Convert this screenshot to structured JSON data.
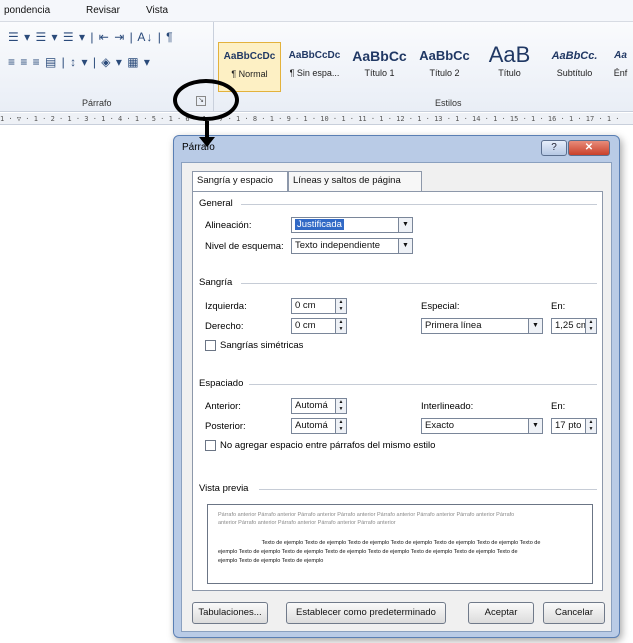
{
  "ribbon": {
    "menu": [
      "pondencia",
      "Revisar",
      "Vista"
    ],
    "paragraph_row1": "☰ ▾ ☰ ▾ ☰ ▾ | ⇤ ⇥ | A↓ | ¶",
    "paragraph_row2": "≡ ≡ ≡ ▤ | ↕ ▾ | ◈ ▾ ▦ ▾",
    "paragraph_group_label": "Párrafo",
    "launcher_glyph": "↘",
    "styles_group_label": "Estilos",
    "styles": [
      {
        "sample": "AaBbCcDc",
        "name": "¶ Normal"
      },
      {
        "sample": "AaBbCcDc",
        "name": "¶ Sin espa..."
      },
      {
        "sample": "AaBbCc",
        "name": "Título 1"
      },
      {
        "sample": "AaBbCc",
        "name": "Título 2"
      },
      {
        "sample": "AaB",
        "name": "Título"
      },
      {
        "sample": "AaBbCc.",
        "name": "Subtítulo"
      },
      {
        "sample": "Aa",
        "name": "Énf"
      }
    ]
  },
  "ruler_text": "1 · ▽ · 1 · 2 · 1 · 3 · 1 · 4 · 1 · 5 · 1 · 6 · 1 · 7 · 1 · 8 · 1 · 9 · 1 · 10 · 1 · 11 · 1 · 12 · 1 · 13 · 1 · 14 · 1 · 15 · 1 · 16 · 1 · 17 · 1 ·",
  "dialog": {
    "title": "Párrafo",
    "help_glyph": "?",
    "close_glyph": "✕",
    "tabs": [
      "Sangría y espacio",
      "Líneas y saltos de página"
    ],
    "general": {
      "heading": "General",
      "alignment_label": "Alineación:",
      "alignment_value": "Justificada",
      "outline_label": "Nivel de esquema:",
      "outline_value": "Texto independiente"
    },
    "indent": {
      "heading": "Sangría",
      "left_label": "Izquierda:",
      "left_value": "0 cm",
      "right_label": "Derecho:",
      "right_value": "0 cm",
      "special_label": "Especial:",
      "special_value": "Primera línea",
      "by_label": "En:",
      "by_value": "1,25 cm",
      "mirror_label": "Sangrías simétricas"
    },
    "spacing": {
      "heading": "Espaciado",
      "before_label": "Anterior:",
      "before_value": "Automá",
      "after_label": "Posterior:",
      "after_value": "Automá",
      "line_label": "Interlineado:",
      "line_value": "Exacto",
      "at_label": "En:",
      "at_value": "17 pto",
      "no_space_label": "No agregar espacio entre párrafos del mismo estilo"
    },
    "preview": {
      "heading": "Vista previa",
      "prev_line1": "Párrafo anterior Párrafo anterior Párrafo anterior Párrafo anterior Párrafo anterior Párrafo anterior Párrafo anterior Párrafo",
      "prev_line2": "anterior Párrafo anterior Párrafo anterior Párrafo anterior Párrafo anterior",
      "sample_line1": "Texto de ejemplo Texto de ejemplo Texto de ejemplo Texto de ejemplo Texto de ejemplo Texto de ejemplo Texto de",
      "sample_line2": "ejemplo Texto de ejemplo Texto de ejemplo Texto de ejemplo Texto de ejemplo Texto de ejemplo Texto de ejemplo Texto de",
      "sample_line3": "ejemplo Texto de ejemplo Texto de ejemplo"
    },
    "buttons": {
      "tabs": "Tabulaciones...",
      "default": "Establecer como predeterminado",
      "ok": "Aceptar",
      "cancel": "Cancelar"
    }
  },
  "colors": {
    "selection": "#3169c6",
    "dialog_frame": "#b9cbe6",
    "close_button": "#c9402a",
    "selected_style": "#fdf0c4"
  }
}
